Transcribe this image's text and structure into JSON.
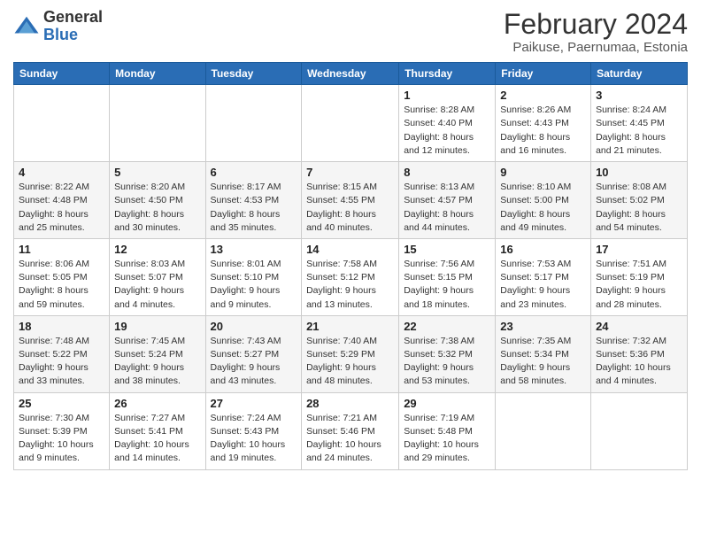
{
  "logo": {
    "text_general": "General",
    "text_blue": "Blue",
    "tagline": "GeneralBlue"
  },
  "title": "February 2024",
  "subtitle": "Paikuse, Paernumaa, Estonia",
  "days_of_week": [
    "Sunday",
    "Monday",
    "Tuesday",
    "Wednesday",
    "Thursday",
    "Friday",
    "Saturday"
  ],
  "weeks": [
    [
      {
        "day": "",
        "info": ""
      },
      {
        "day": "",
        "info": ""
      },
      {
        "day": "",
        "info": ""
      },
      {
        "day": "",
        "info": ""
      },
      {
        "day": "1",
        "info": "Sunrise: 8:28 AM\nSunset: 4:40 PM\nDaylight: 8 hours and 12 minutes."
      },
      {
        "day": "2",
        "info": "Sunrise: 8:26 AM\nSunset: 4:43 PM\nDaylight: 8 hours and 16 minutes."
      },
      {
        "day": "3",
        "info": "Sunrise: 8:24 AM\nSunset: 4:45 PM\nDaylight: 8 hours and 21 minutes."
      }
    ],
    [
      {
        "day": "4",
        "info": "Sunrise: 8:22 AM\nSunset: 4:48 PM\nDaylight: 8 hours and 25 minutes."
      },
      {
        "day": "5",
        "info": "Sunrise: 8:20 AM\nSunset: 4:50 PM\nDaylight: 8 hours and 30 minutes."
      },
      {
        "day": "6",
        "info": "Sunrise: 8:17 AM\nSunset: 4:53 PM\nDaylight: 8 hours and 35 minutes."
      },
      {
        "day": "7",
        "info": "Sunrise: 8:15 AM\nSunset: 4:55 PM\nDaylight: 8 hours and 40 minutes."
      },
      {
        "day": "8",
        "info": "Sunrise: 8:13 AM\nSunset: 4:57 PM\nDaylight: 8 hours and 44 minutes."
      },
      {
        "day": "9",
        "info": "Sunrise: 8:10 AM\nSunset: 5:00 PM\nDaylight: 8 hours and 49 minutes."
      },
      {
        "day": "10",
        "info": "Sunrise: 8:08 AM\nSunset: 5:02 PM\nDaylight: 8 hours and 54 minutes."
      }
    ],
    [
      {
        "day": "11",
        "info": "Sunrise: 8:06 AM\nSunset: 5:05 PM\nDaylight: 8 hours and 59 minutes."
      },
      {
        "day": "12",
        "info": "Sunrise: 8:03 AM\nSunset: 5:07 PM\nDaylight: 9 hours and 4 minutes."
      },
      {
        "day": "13",
        "info": "Sunrise: 8:01 AM\nSunset: 5:10 PM\nDaylight: 9 hours and 9 minutes."
      },
      {
        "day": "14",
        "info": "Sunrise: 7:58 AM\nSunset: 5:12 PM\nDaylight: 9 hours and 13 minutes."
      },
      {
        "day": "15",
        "info": "Sunrise: 7:56 AM\nSunset: 5:15 PM\nDaylight: 9 hours and 18 minutes."
      },
      {
        "day": "16",
        "info": "Sunrise: 7:53 AM\nSunset: 5:17 PM\nDaylight: 9 hours and 23 minutes."
      },
      {
        "day": "17",
        "info": "Sunrise: 7:51 AM\nSunset: 5:19 PM\nDaylight: 9 hours and 28 minutes."
      }
    ],
    [
      {
        "day": "18",
        "info": "Sunrise: 7:48 AM\nSunset: 5:22 PM\nDaylight: 9 hours and 33 minutes."
      },
      {
        "day": "19",
        "info": "Sunrise: 7:45 AM\nSunset: 5:24 PM\nDaylight: 9 hours and 38 minutes."
      },
      {
        "day": "20",
        "info": "Sunrise: 7:43 AM\nSunset: 5:27 PM\nDaylight: 9 hours and 43 minutes."
      },
      {
        "day": "21",
        "info": "Sunrise: 7:40 AM\nSunset: 5:29 PM\nDaylight: 9 hours and 48 minutes."
      },
      {
        "day": "22",
        "info": "Sunrise: 7:38 AM\nSunset: 5:32 PM\nDaylight: 9 hours and 53 minutes."
      },
      {
        "day": "23",
        "info": "Sunrise: 7:35 AM\nSunset: 5:34 PM\nDaylight: 9 hours and 58 minutes."
      },
      {
        "day": "24",
        "info": "Sunrise: 7:32 AM\nSunset: 5:36 PM\nDaylight: 10 hours and 4 minutes."
      }
    ],
    [
      {
        "day": "25",
        "info": "Sunrise: 7:30 AM\nSunset: 5:39 PM\nDaylight: 10 hours and 9 minutes."
      },
      {
        "day": "26",
        "info": "Sunrise: 7:27 AM\nSunset: 5:41 PM\nDaylight: 10 hours and 14 minutes."
      },
      {
        "day": "27",
        "info": "Sunrise: 7:24 AM\nSunset: 5:43 PM\nDaylight: 10 hours and 19 minutes."
      },
      {
        "day": "28",
        "info": "Sunrise: 7:21 AM\nSunset: 5:46 PM\nDaylight: 10 hours and 24 minutes."
      },
      {
        "day": "29",
        "info": "Sunrise: 7:19 AM\nSunset: 5:48 PM\nDaylight: 10 hours and 29 minutes."
      },
      {
        "day": "",
        "info": ""
      },
      {
        "day": "",
        "info": ""
      }
    ]
  ]
}
